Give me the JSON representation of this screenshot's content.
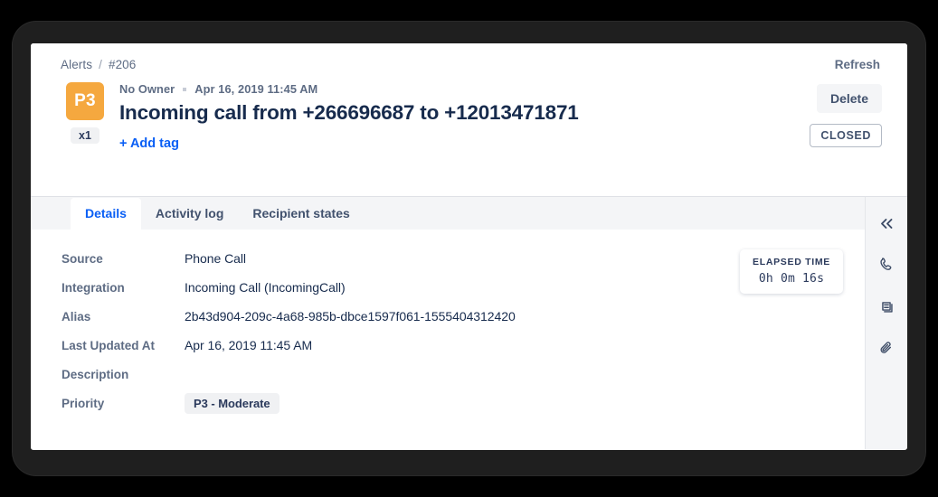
{
  "breadcrumb": {
    "root": "Alerts",
    "separator": "/",
    "current": "#206"
  },
  "header": {
    "priority_badge": "P3",
    "count_badge": "x1",
    "owner": "No Owner",
    "timestamp": "Apr 16, 2019 11:45 AM",
    "title": "Incoming call from +266696687 to +12013471871",
    "add_tag_label": "+ Add tag",
    "refresh_label": "Refresh",
    "delete_label": "Delete",
    "status_label": "CLOSED"
  },
  "tabs": [
    {
      "label": "Details",
      "active": true
    },
    {
      "label": "Activity log",
      "active": false
    },
    {
      "label": "Recipient states",
      "active": false
    }
  ],
  "details": {
    "fields": [
      {
        "label": "Source",
        "value": "Phone Call",
        "chip": false
      },
      {
        "label": "Integration",
        "value": "Incoming Call (IncomingCall)",
        "chip": false
      },
      {
        "label": "Alias",
        "value": "2b43d904-209c-4a68-985b-dbce1597f061-1555404312420",
        "chip": false
      },
      {
        "label": "Last Updated At",
        "value": "Apr 16, 2019 11:45 AM",
        "chip": false
      },
      {
        "label": "Description",
        "value": "",
        "chip": false
      },
      {
        "label": "Priority",
        "value": "P3 - Moderate",
        "chip": true
      }
    ]
  },
  "elapsed_time": {
    "title": "ELAPSED TIME",
    "value": "0h 0m  16s"
  },
  "icon_rail": [
    {
      "name": "collapse-panel",
      "icon": "chevron-double-left-icon"
    },
    {
      "name": "call",
      "icon": "phone-icon"
    },
    {
      "name": "notes",
      "icon": "notes-icon"
    },
    {
      "name": "attachments",
      "icon": "paperclip-icon"
    }
  ],
  "colors": {
    "priority_orange": "#f5a83f",
    "link_blue": "#0a5ff5",
    "text_dark": "#172b4d",
    "text_muted": "#5e6c84",
    "strip_gray": "#f4f5f7"
  }
}
